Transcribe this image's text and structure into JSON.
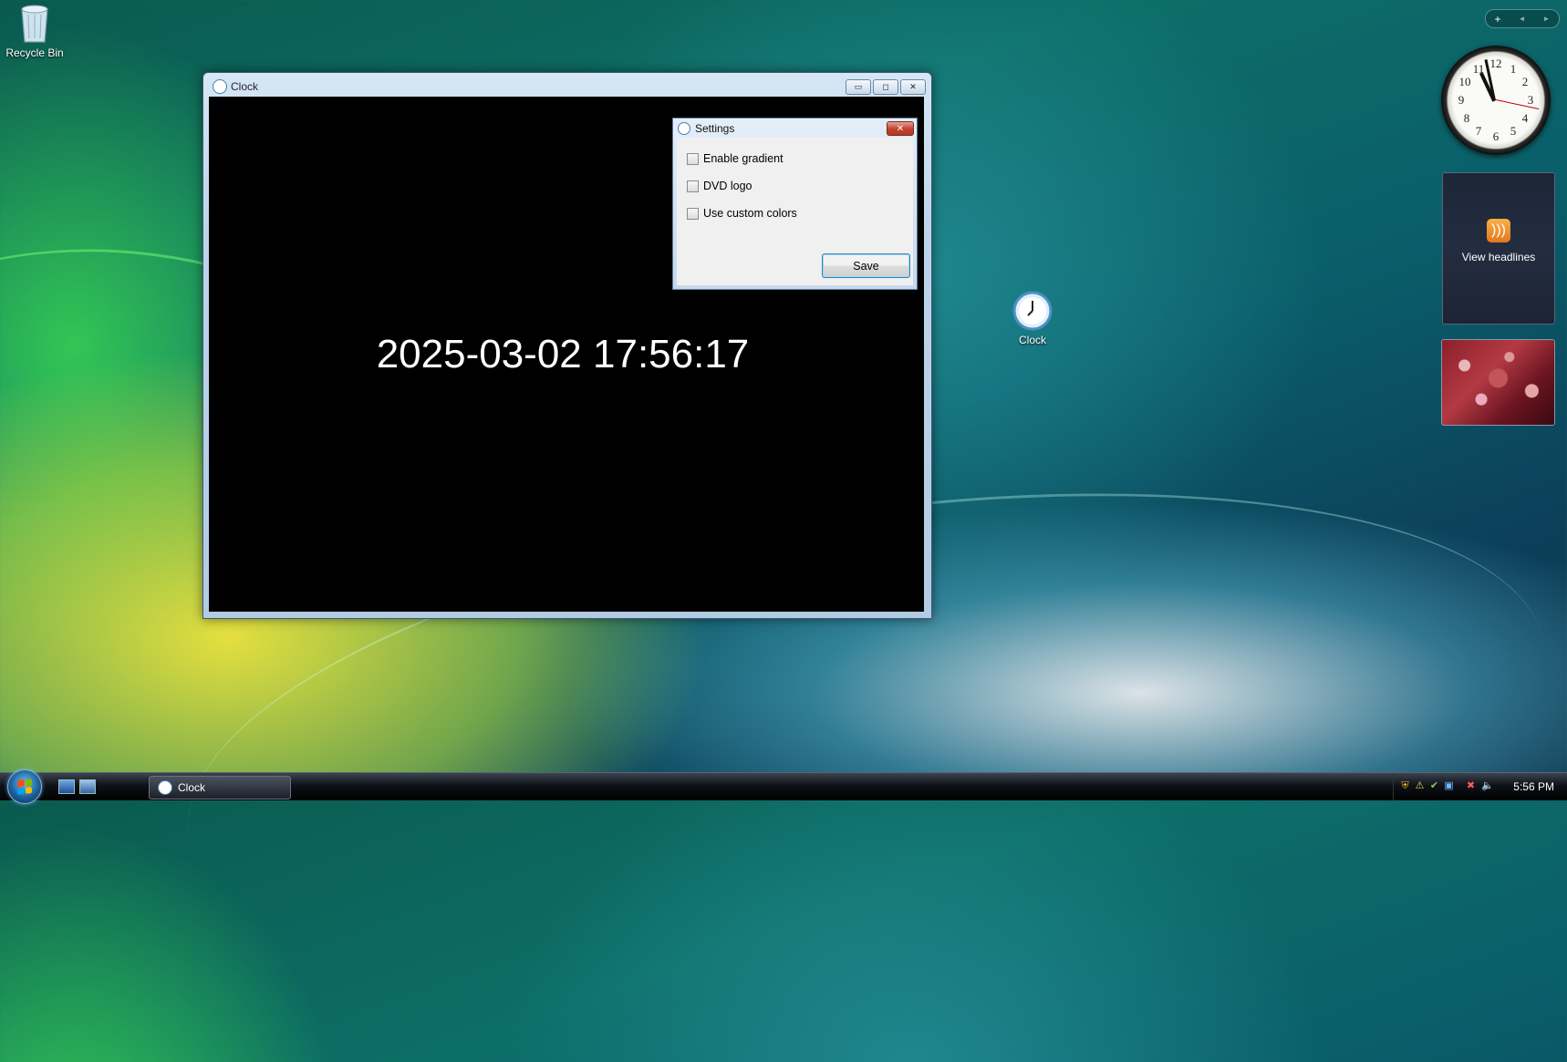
{
  "desktop": {
    "icons": [
      {
        "label": "Recycle Bin"
      },
      {
        "label": "Clock"
      }
    ]
  },
  "window": {
    "title": "Clock",
    "clock_text": "2025-03-02 17:56:17",
    "buttons": {
      "minimize": "▭",
      "maximize": "◻",
      "close": "✕"
    }
  },
  "settings": {
    "title": "Settings",
    "close": "✕",
    "checkboxes": [
      {
        "label": "Enable gradient",
        "checked": false
      },
      {
        "label": "DVD logo",
        "checked": false
      },
      {
        "label": "Use custom colors",
        "checked": false
      }
    ],
    "save_label": "Save"
  },
  "sidebar": {
    "controls": {
      "add": "+",
      "prev": "◄",
      "next": "►"
    },
    "feed_label": "View headlines",
    "feed_icon": "rss-icon",
    "clock_numbers": [
      "12",
      "1",
      "2",
      "3",
      "4",
      "5",
      "6",
      "7",
      "8",
      "9",
      "10",
      "11"
    ]
  },
  "taskbar": {
    "task_button_label": "Clock",
    "time": "5:56 PM"
  }
}
